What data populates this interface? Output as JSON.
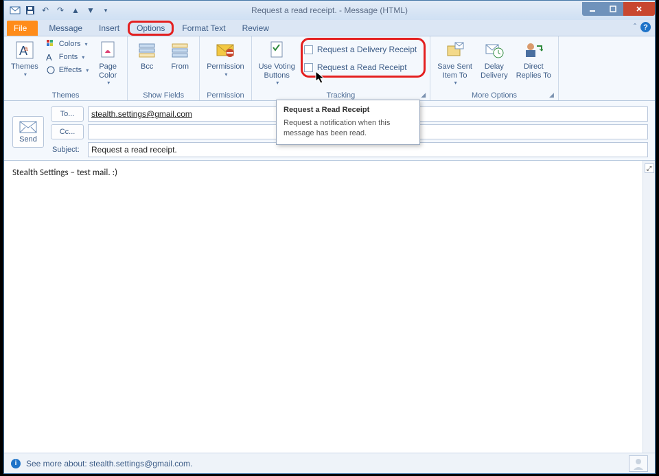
{
  "window": {
    "title": "Request a read receipt.  -  Message (HTML)"
  },
  "tabs": {
    "file": "File",
    "message": "Message",
    "insert": "Insert",
    "options": "Options",
    "format_text": "Format Text",
    "review": "Review"
  },
  "ribbon": {
    "themes": {
      "label": "Themes",
      "themes_btn": "Themes",
      "colors": "Colors",
      "fonts": "Fonts",
      "effects": "Effects",
      "page_color": "Page\nColor"
    },
    "show_fields": {
      "label": "Show Fields",
      "bcc": "Bcc",
      "from": "From"
    },
    "permission": {
      "label": "Permission",
      "btn": "Permission"
    },
    "tracking": {
      "label": "Tracking",
      "voting": "Use Voting\nButtons",
      "delivery": "Request a Delivery Receipt",
      "read": "Request a Read Receipt"
    },
    "more": {
      "label": "More Options",
      "save_sent": "Save Sent\nItem To",
      "delay": "Delay\nDelivery",
      "direct": "Direct\nReplies To"
    }
  },
  "compose": {
    "send": "Send",
    "to_btn": "To...",
    "cc_btn": "Cc...",
    "subject_lbl": "Subject:",
    "to_value": "stealth.settings@gmail.com",
    "cc_value": "",
    "subject_value": "Request a read receipt."
  },
  "body_text": "Stealth Settings – test mail. :)",
  "tooltip": {
    "title": "Request a Read Receipt",
    "body": "Request a notification when this message has been read."
  },
  "status": {
    "text": "See more about: stealth.settings@gmail.com."
  }
}
